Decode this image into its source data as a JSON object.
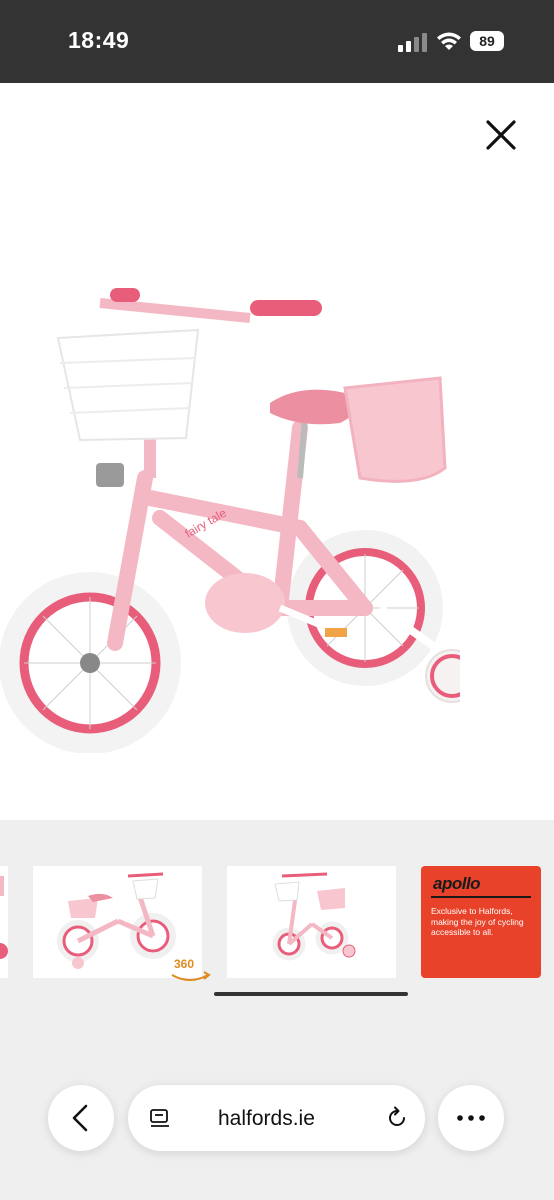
{
  "status_bar": {
    "time": "18:49",
    "battery": "89"
  },
  "viewer": {
    "close_icon": "close-icon",
    "image_subject": "pink children's bicycle with basket, doll seat and stabilisers"
  },
  "gallery": {
    "badge_360": "360",
    "promo": {
      "brand": "apollo",
      "tagline": "Exclusive to Halfords, making the joy of cycling accessible to all."
    }
  },
  "browser": {
    "url": "halfords.ie"
  },
  "colors": {
    "status_bg": "#333333",
    "gallery_bg": "#efefef",
    "promo_bg": "#e8432a",
    "bike_pink": "#f4b8c4",
    "rim_pink": "#e85d7a",
    "badge_orange": "#e08a1e"
  }
}
